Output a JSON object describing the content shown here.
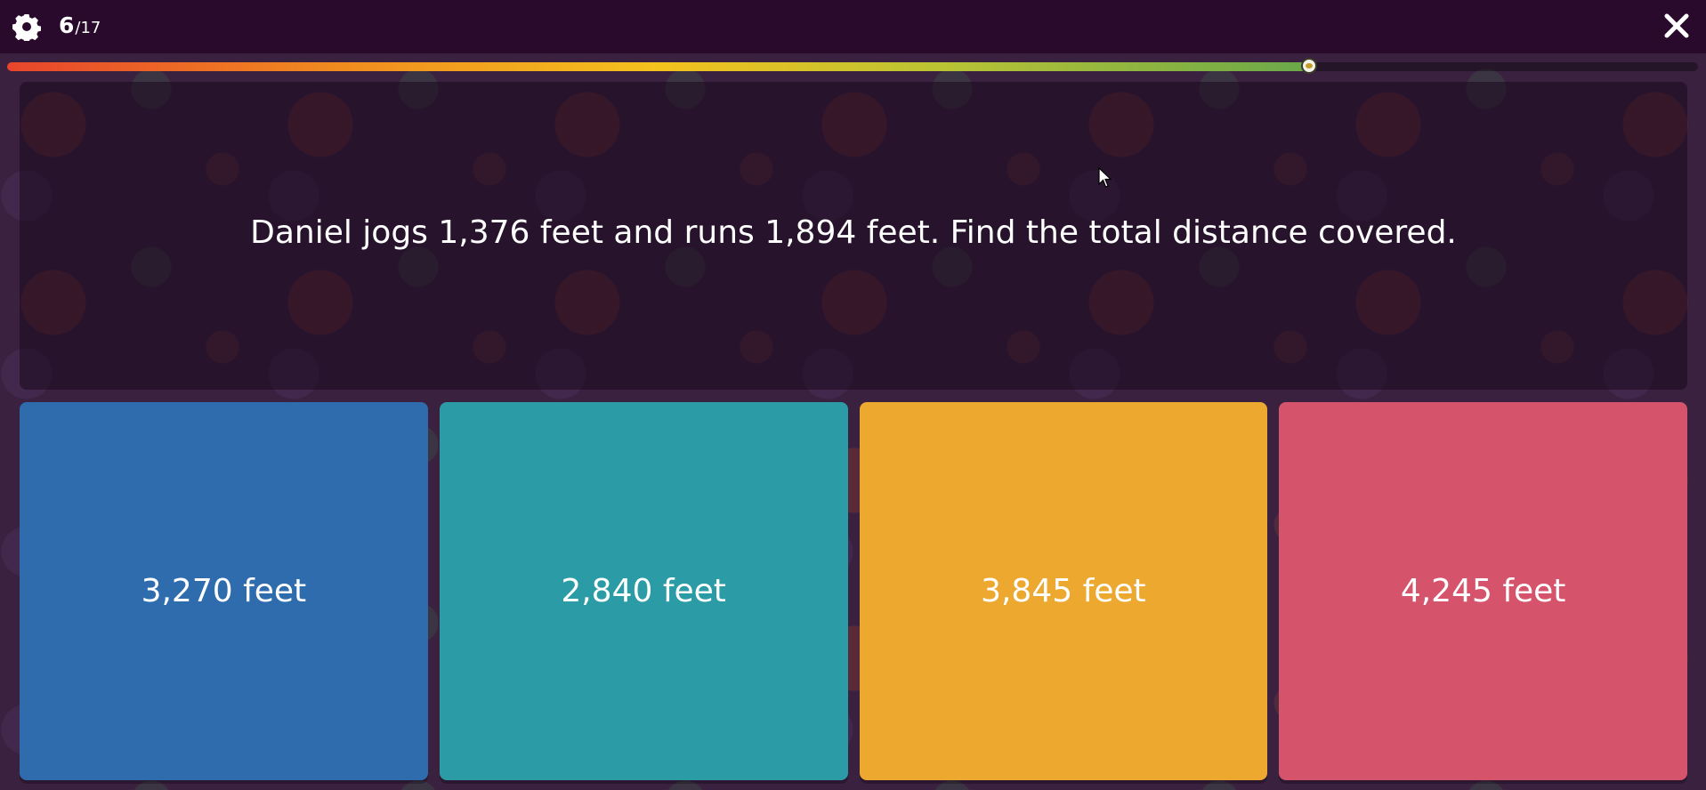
{
  "header": {
    "settings_icon": "gear-icon",
    "current_question": "6",
    "separator": "/",
    "total_questions": "17",
    "close_icon": "close-icon"
  },
  "progress": {
    "fraction": 0.77,
    "colors": [
      "#e8452c",
      "#f08a1f",
      "#f4c21d",
      "#b9c334",
      "#6aa84a"
    ]
  },
  "question": {
    "text": "Daniel jogs 1,376 feet and runs 1,894 feet. Find the total distance covered."
  },
  "options": [
    {
      "label": "3,270 feet",
      "color": "#2f6cae"
    },
    {
      "label": "2,840 feet",
      "color": "#2b9ba6"
    },
    {
      "label": "3,845 feet",
      "color": "#eca82f"
    },
    {
      "label": "4,245 feet",
      "color": "#d6546b"
    }
  ]
}
